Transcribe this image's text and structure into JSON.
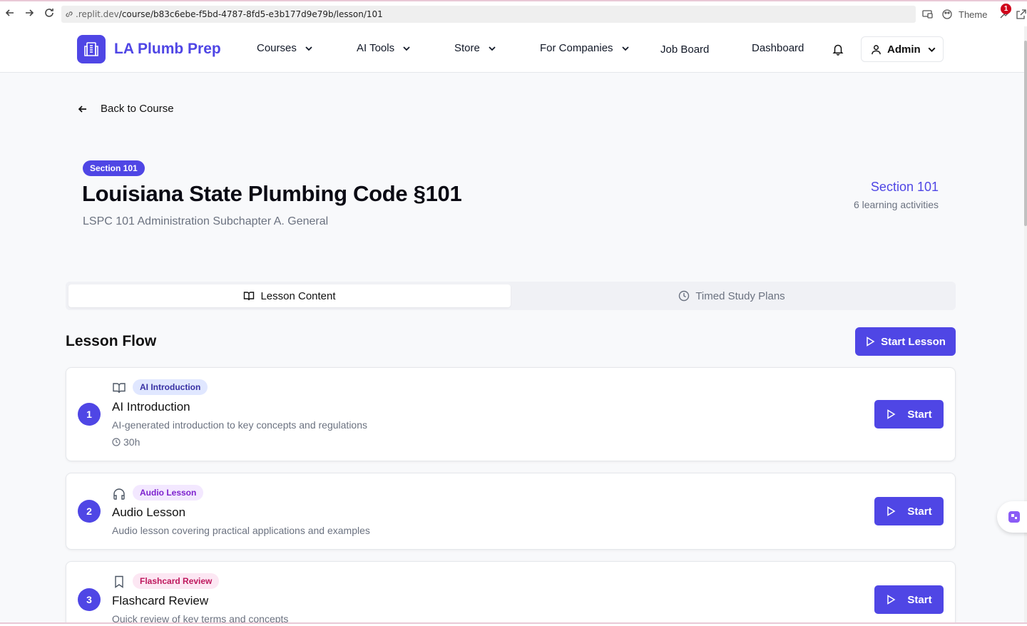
{
  "browser": {
    "url_host": ".replit.dev",
    "url_path": "/course/b83c6ebe-f5bd-4787-8fd5-e3b177d9e79b/lesson/101",
    "theme_label": "Theme",
    "ext_badge_count": "1"
  },
  "header": {
    "brand": "LA Plumb Prep",
    "nav": [
      {
        "label": "Courses"
      },
      {
        "label": "AI Tools"
      },
      {
        "label": "Store"
      },
      {
        "label": "For Companies"
      },
      {
        "label": "Job Board"
      },
      {
        "label": "Dashboard"
      }
    ],
    "user_label": "Admin"
  },
  "back_link": "Back to Course",
  "lesson": {
    "badge": "Section 101",
    "title": "Louisiana State Plumbing Code §101",
    "subtitle": "LSPC 101 Administration Subchapter A. General",
    "side_section": "Section 101",
    "side_count": "6 learning activities"
  },
  "tabs": {
    "active": "Lesson Content",
    "inactive": "Timed Study Plans"
  },
  "flow": {
    "title": "Lesson Flow",
    "start_lesson": "Start Lesson",
    "items": [
      {
        "num": "1",
        "icon": "book-open-icon",
        "tag": "AI Introduction",
        "title": "AI Introduction",
        "desc": "AI-generated introduction to key concepts and regulations",
        "duration": "30h",
        "start": "Start"
      },
      {
        "num": "2",
        "icon": "headphones-icon",
        "tag": "Audio Lesson",
        "title": "Audio Lesson",
        "desc": "Audio lesson covering practical applications and examples",
        "start": "Start"
      },
      {
        "num": "3",
        "icon": "bookmark-icon",
        "tag": "Flashcard Review",
        "title": "Flashcard Review",
        "desc": "Quick review of key terms and concepts",
        "start": "Start"
      }
    ]
  },
  "colors": {
    "accent": "#4f46e5",
    "tag_blue_bg": "#e0e7ff",
    "tag_purple_bg": "#f3e8ff",
    "tag_pink_bg": "#fce7f3"
  }
}
